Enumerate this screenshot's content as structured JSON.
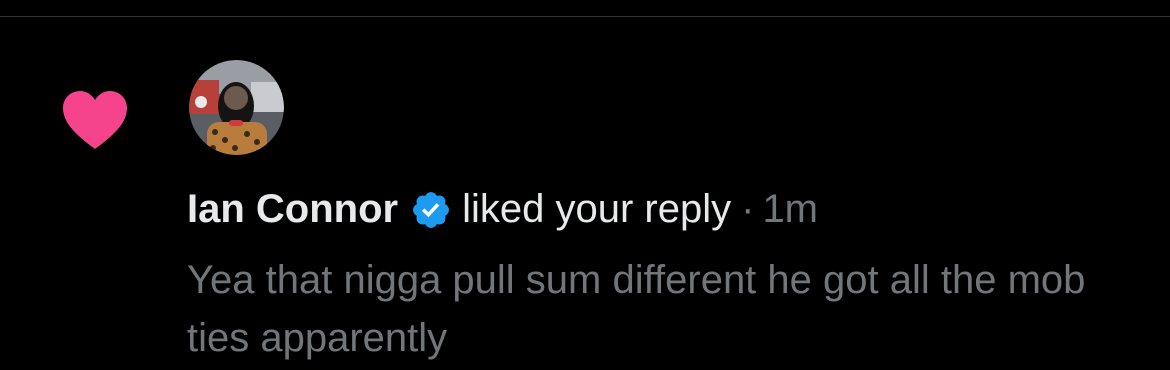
{
  "notification": {
    "type_icon": "heart-icon",
    "author": {
      "name": "Ian Connor",
      "verified_icon": "verified-badge-icon",
      "avatar_icon": "user-avatar"
    },
    "action": "liked your reply",
    "separator": "·",
    "timestamp": "1m",
    "reply_text": "Yea that nigga pull sum different he got all the mob ties apparently"
  },
  "colors": {
    "background": "#000000",
    "primary_text": "#e7e9ea",
    "secondary_text": "#71767b",
    "like_pink": "#f91880",
    "verified_blue": "#1d9bf0",
    "divider": "#2f3336"
  }
}
